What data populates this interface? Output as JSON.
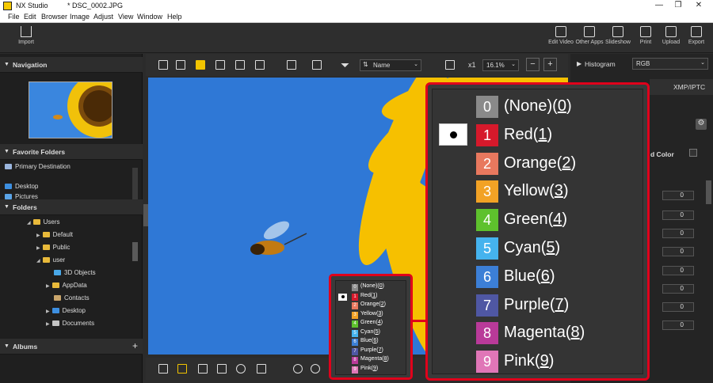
{
  "window": {
    "app_name": "NX Studio",
    "file_name": "* DSC_0002.JPG",
    "controls": {
      "minimize": "—",
      "restore": "❐",
      "close": "✕"
    }
  },
  "menu": [
    "File",
    "Edit",
    "Browser",
    "Image",
    "Adjust",
    "View",
    "Window",
    "Help"
  ],
  "toolbar": {
    "import_label": "Import",
    "right_buttons": [
      {
        "icon": "edit-video-icon",
        "label": "Edit Video"
      },
      {
        "icon": "other-apps-icon",
        "label": "Other Apps"
      },
      {
        "icon": "slideshow-icon",
        "label": "Slideshow"
      },
      {
        "icon": "print-icon",
        "label": "Print"
      },
      {
        "icon": "upload-icon",
        "label": "Upload"
      },
      {
        "icon": "export-icon",
        "label": "Export"
      }
    ]
  },
  "left_panel": {
    "navigation_title": "Navigation",
    "favorite_folders_title": "Favorite Folders",
    "favorites": [
      "Primary Destination",
      "Desktop",
      "Pictures"
    ],
    "folders_title": "Folders",
    "folders": [
      {
        "name": "Users",
        "level": 1,
        "expanded": true
      },
      {
        "name": "Default",
        "level": 2,
        "expanded": false
      },
      {
        "name": "Public",
        "level": 2,
        "expanded": false
      },
      {
        "name": "user",
        "level": 2,
        "expanded": true
      },
      {
        "name": "3D Objects",
        "level": 3,
        "expanded": false
      },
      {
        "name": "AppData",
        "level": 3,
        "expanded": false
      },
      {
        "name": "Contacts",
        "level": 3,
        "expanded": false
      },
      {
        "name": "Desktop",
        "level": 3,
        "expanded": false
      },
      {
        "name": "Documents",
        "level": 3,
        "expanded": false
      }
    ],
    "albums_title": "Albums",
    "albums_add": "+"
  },
  "center_toolbar": {
    "sort_label": "Name",
    "zoom_fit_label": "x1",
    "zoom_value": "16.1%",
    "zoom_out": "−",
    "zoom_in": "+"
  },
  "right_panel": {
    "histogram_label": "Histogram",
    "histogram_mode": "RGB",
    "tab_xmp": "XMP/IPTC",
    "label_fragment": "d Color",
    "field_values": [
      "0",
      "0",
      "0",
      "0",
      "0",
      "0",
      "0",
      "0"
    ]
  },
  "color_label_menu": {
    "items": [
      {
        "num": "0",
        "name": "(None)",
        "key": "0",
        "color": "#8a8a8a",
        "selected": false
      },
      {
        "num": "1",
        "name": "Red",
        "key": "1",
        "color": "#d6192b",
        "selected": true
      },
      {
        "num": "2",
        "name": "Orange",
        "key": "2",
        "color": "#e8785e",
        "selected": false
      },
      {
        "num": "3",
        "name": "Yellow",
        "key": "3",
        "color": "#f2a225",
        "selected": false
      },
      {
        "num": "4",
        "name": "Green",
        "key": "4",
        "color": "#5ec12d",
        "selected": false
      },
      {
        "num": "5",
        "name": "Cyan",
        "key": "5",
        "color": "#45b3ee",
        "selected": false
      },
      {
        "num": "6",
        "name": "Blue",
        "key": "6",
        "color": "#3c7fd6",
        "selected": false
      },
      {
        "num": "7",
        "name": "Purple",
        "key": "7",
        "color": "#4f57a3",
        "selected": false
      },
      {
        "num": "8",
        "name": "Magenta",
        "key": "8",
        "color": "#b93a99",
        "selected": false
      },
      {
        "num": "9",
        "name": "Pink",
        "key": "9",
        "color": "#e076b7",
        "selected": false
      }
    ],
    "highlight_color": "#e0001b"
  }
}
